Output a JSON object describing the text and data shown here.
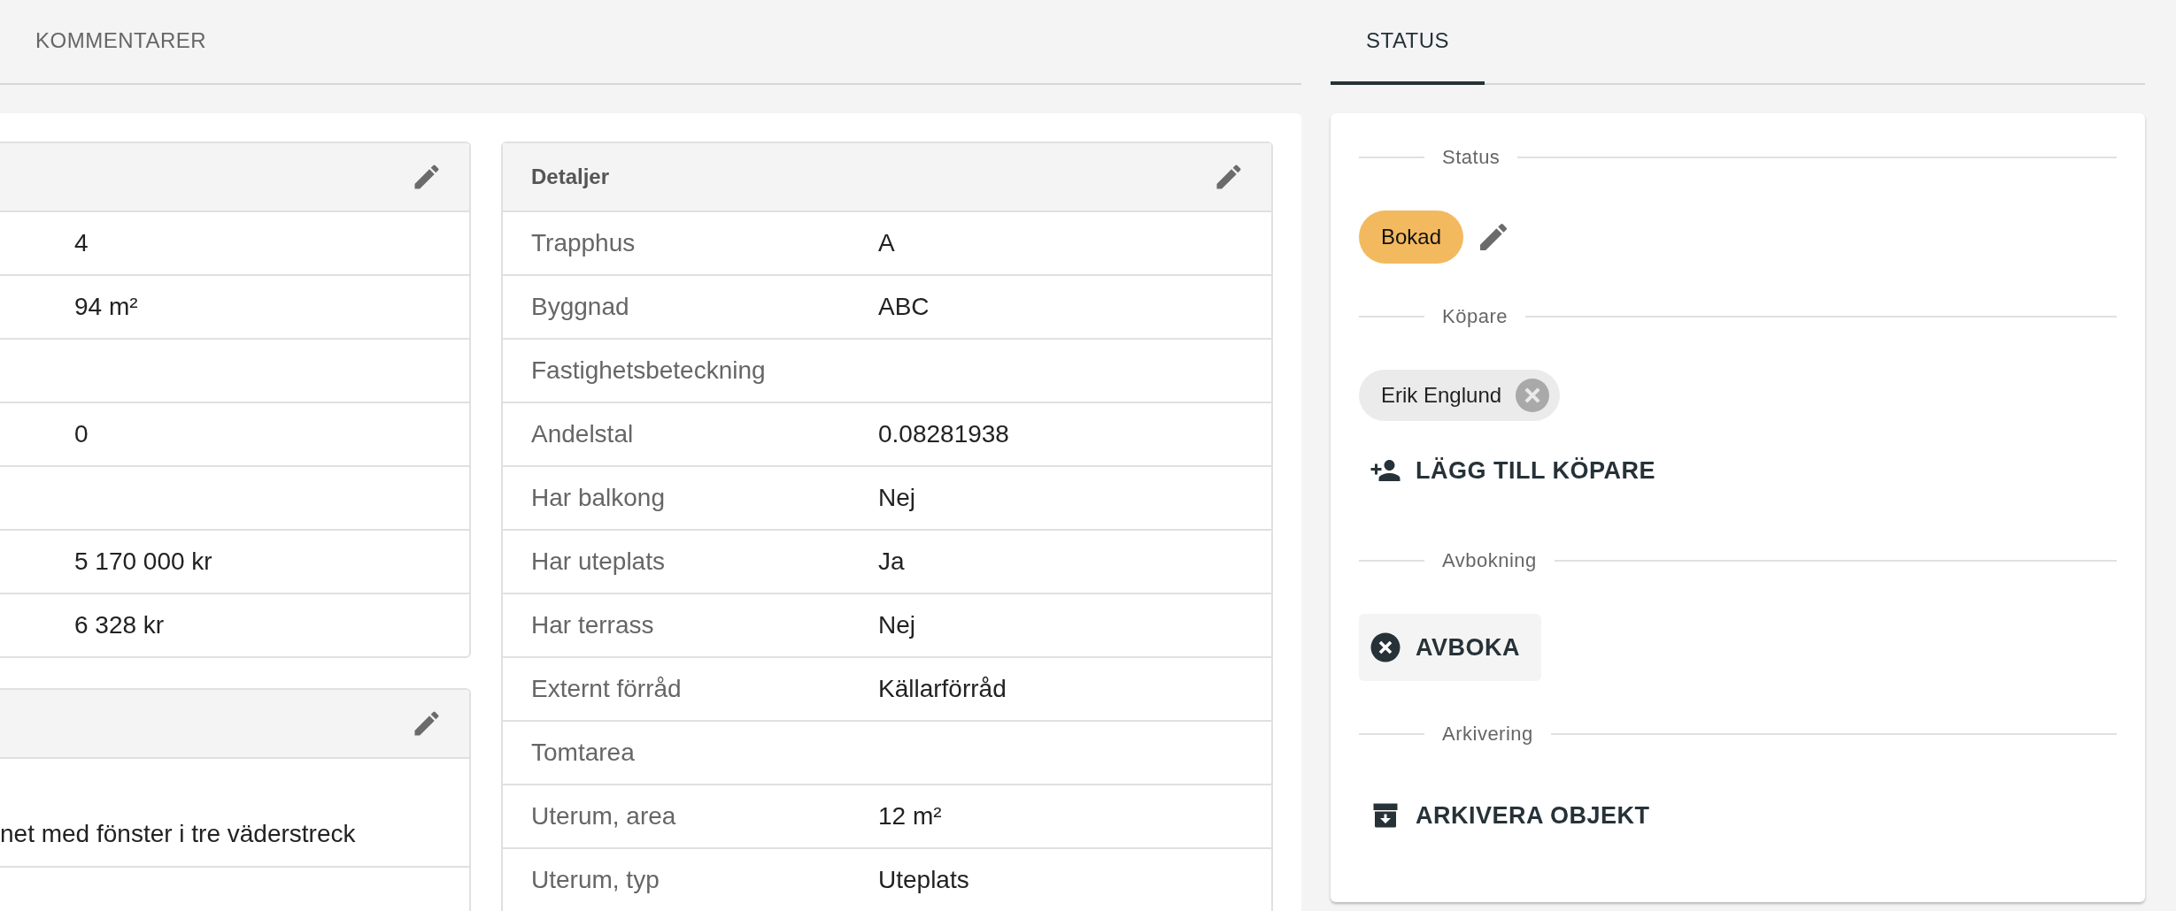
{
  "left_tabs": [
    {
      "label": "KOMMENTARER",
      "selected": false
    }
  ],
  "left_cards": [
    {
      "rows": [
        {
          "value": "4"
        },
        {
          "value": "94 m²"
        },
        {},
        {
          "value": "0"
        },
        {},
        {
          "value": "5 170 000 kr"
        },
        {
          "value": "6 328 kr"
        }
      ]
    },
    {
      "rows": [
        {
          "value": "net med fönster i tre väderstreck"
        },
        {}
      ]
    }
  ],
  "details_card": {
    "title": "Detaljer",
    "rows": [
      {
        "label": "Trapphus",
        "value": "A"
      },
      {
        "label": "Byggnad",
        "value": "ABC"
      },
      {
        "label": "Fastighetsbeteckning"
      },
      {
        "label": "Andelstal",
        "value": "0.08281938"
      },
      {
        "label": "Har balkong",
        "value": "Nej"
      },
      {
        "label": "Har uteplats",
        "value": "Ja"
      },
      {
        "label": "Har terrass",
        "value": "Nej"
      },
      {
        "label": "Externt förråd",
        "value": "Källarförråd"
      },
      {
        "label": "Tomtarea"
      },
      {
        "label": "Uterum, area",
        "value": "12 m²"
      },
      {
        "label": "Uterum, typ",
        "value": "Uteplats"
      }
    ]
  },
  "status_panel": {
    "tabs": [
      {
        "label": "STATUS",
        "selected": true
      }
    ],
    "sections": [
      {
        "kind": "status",
        "heading": "Status",
        "chip": "Bokad",
        "color": "#f3b95f"
      },
      {
        "kind": "buyers",
        "heading": "Köpare",
        "buyers": [
          "Erik Englund"
        ],
        "action": "LÄGG TILL KÖPARE"
      },
      {
        "kind": "cancel",
        "heading": "Avbokning",
        "action": "AVBOKA"
      },
      {
        "kind": "archive",
        "heading": "Arkivering",
        "action": "ARKIVERA OBJEKT"
      }
    ]
  }
}
